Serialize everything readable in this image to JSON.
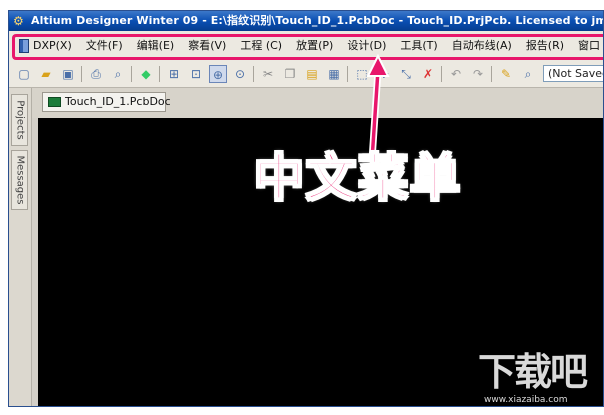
{
  "window": {
    "title": "Altium Designer Winter 09 - E:\\指纹识别\\Touch_ID_1.PcbDoc - Touch_ID.PrjPcb. Licensed to jmj"
  },
  "menubar": {
    "items": [
      "DXP(X)",
      "文件(F)",
      "编辑(E)",
      "察看(V)",
      "工程 (C)",
      "放置(P)",
      "设计(D)",
      "工具(T)",
      "自动布线(A)",
      "报告(R)",
      "窗口"
    ]
  },
  "toolbar": {
    "combo_value": "(Not Saved)"
  },
  "left_panel": {
    "tabs": [
      "Projects",
      "Messages"
    ]
  },
  "document": {
    "tab_label": "Touch_ID_1.PcbDoc"
  },
  "annotation": {
    "text": "中文菜单",
    "color": "#e8176b"
  },
  "watermark": {
    "main": "下载吧",
    "sub": "www.xiazaiba.com"
  },
  "colors": {
    "titlebar": "#0a4fb3",
    "canvas": "#000000",
    "highlight": "#e8176b"
  }
}
